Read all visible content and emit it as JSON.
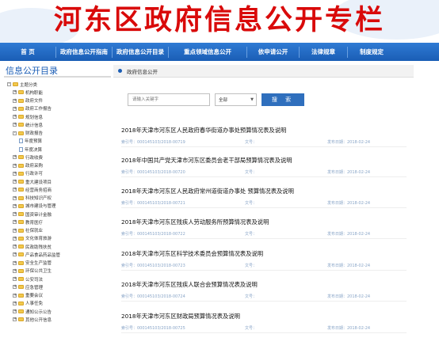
{
  "banner": {
    "title": "河东区政府信息公开专栏"
  },
  "navbar": {
    "items": [
      "首 页",
      "政府信息公开指南",
      "政府信息公开目录",
      "重点领域信息公开",
      "依申请公开",
      "法律规章",
      "制度规定"
    ]
  },
  "sidebar": {
    "title": "信息公开目录",
    "tree": [
      {
        "label": "主题分类",
        "level": 0,
        "type": "folder",
        "exp": "-"
      },
      {
        "label": "机构职能",
        "level": 1,
        "type": "folder",
        "exp": "+"
      },
      {
        "label": "政府文件",
        "level": 1,
        "type": "folder",
        "exp": "+"
      },
      {
        "label": "政府工作报告",
        "level": 1,
        "type": "folder",
        "exp": "+"
      },
      {
        "label": "规划信息",
        "level": 1,
        "type": "folder",
        "exp": "+"
      },
      {
        "label": "统计信息",
        "level": 1,
        "type": "folder",
        "exp": "+"
      },
      {
        "label": "财政报告",
        "level": 1,
        "type": "folder",
        "exp": "-"
      },
      {
        "label": "年度预算",
        "level": 2,
        "type": "doc",
        "exp": ""
      },
      {
        "label": "年度决算",
        "level": 2,
        "type": "doc",
        "exp": ""
      },
      {
        "label": "行政收费",
        "level": 1,
        "type": "folder",
        "exp": "+"
      },
      {
        "label": "政府采购",
        "level": 1,
        "type": "folder",
        "exp": "+"
      },
      {
        "label": "行政许可",
        "level": 1,
        "type": "folder",
        "exp": "+"
      },
      {
        "label": "重大建设项目",
        "level": 1,
        "type": "folder",
        "exp": "+"
      },
      {
        "label": "经营商务招商",
        "level": 1,
        "type": "folder",
        "exp": "+"
      },
      {
        "label": "科技知识产权",
        "level": 1,
        "type": "folder",
        "exp": "+"
      },
      {
        "label": "城市建设与管理",
        "level": 1,
        "type": "folder",
        "exp": "+"
      },
      {
        "label": "国资审计金融",
        "level": 1,
        "type": "folder",
        "exp": "+"
      },
      {
        "label": "教育医疗",
        "level": 1,
        "type": "folder",
        "exp": "+"
      },
      {
        "label": "社保就业",
        "level": 1,
        "type": "folder",
        "exp": "+"
      },
      {
        "label": "文化体育旅游",
        "level": 1,
        "type": "folder",
        "exp": "+"
      },
      {
        "label": "民政助残扶贫",
        "level": 1,
        "type": "folder",
        "exp": "+"
      },
      {
        "label": "产品食品药品监管",
        "level": 1,
        "type": "folder",
        "exp": "+"
      },
      {
        "label": "安全生产监管",
        "level": 1,
        "type": "folder",
        "exp": "+"
      },
      {
        "label": "环保公共卫生",
        "level": 1,
        "type": "folder",
        "exp": "+"
      },
      {
        "label": "公安司法",
        "level": 1,
        "type": "folder",
        "exp": "+"
      },
      {
        "label": "应急管理",
        "level": 1,
        "type": "folder",
        "exp": "+"
      },
      {
        "label": "重要会议",
        "level": 1,
        "type": "folder",
        "exp": "+"
      },
      {
        "label": "人事任免",
        "level": 1,
        "type": "folder",
        "exp": "+"
      },
      {
        "label": "通知公示公告",
        "level": 1,
        "type": "folder",
        "exp": "+"
      },
      {
        "label": "其他公开信息",
        "level": 1,
        "type": "folder",
        "exp": "+"
      }
    ]
  },
  "main": {
    "header": "政府信息公开",
    "search": {
      "placeholder": "请输入关键字",
      "select": "全部",
      "button": "搜 索"
    },
    "articles": [
      {
        "title": "2018年天津市河东区人民政府春华街道办事处预算情况表及说明",
        "index": "索引号：000145103/2018-00719",
        "num": "文号：",
        "date": "发布日期：2018-02-24"
      },
      {
        "title": "2018年中国共产党天津市河东区委员会老干部局预算情况表及说明",
        "index": "索引号：000145103/2018-00720",
        "num": "文号：",
        "date": "发布日期：2018-02-24"
      },
      {
        "title": "2018年天津市河东区人民政府常州道街道办事处 预算情况表及说明",
        "index": "索引号：000145103/2018-00721",
        "num": "文号：",
        "date": "发布日期：2018-02-24"
      },
      {
        "title": "2018年天津市河东区残疾人劳动服务所预算情况表及说明",
        "index": "索引号：000145103/2018-00722",
        "num": "文号：",
        "date": "发布日期：2018-02-24"
      },
      {
        "title": "2018年天津市河东区科学技术委员会预算情况表及说明",
        "index": "索引号：000145103/2018-00723",
        "num": "文号：",
        "date": "发布日期：2018-02-24"
      },
      {
        "title": "2018年天津市河东区残疾人联合会预算情况表及说明",
        "index": "索引号：000145103/2018-00724",
        "num": "文号：",
        "date": "发布日期：2018-02-24"
      },
      {
        "title": "2018年天津市河东区财政局预算情况表及说明",
        "index": "索引号：000145103/2018-00725",
        "num": "文号：",
        "date": "发布日期：2018-02-24"
      }
    ]
  }
}
